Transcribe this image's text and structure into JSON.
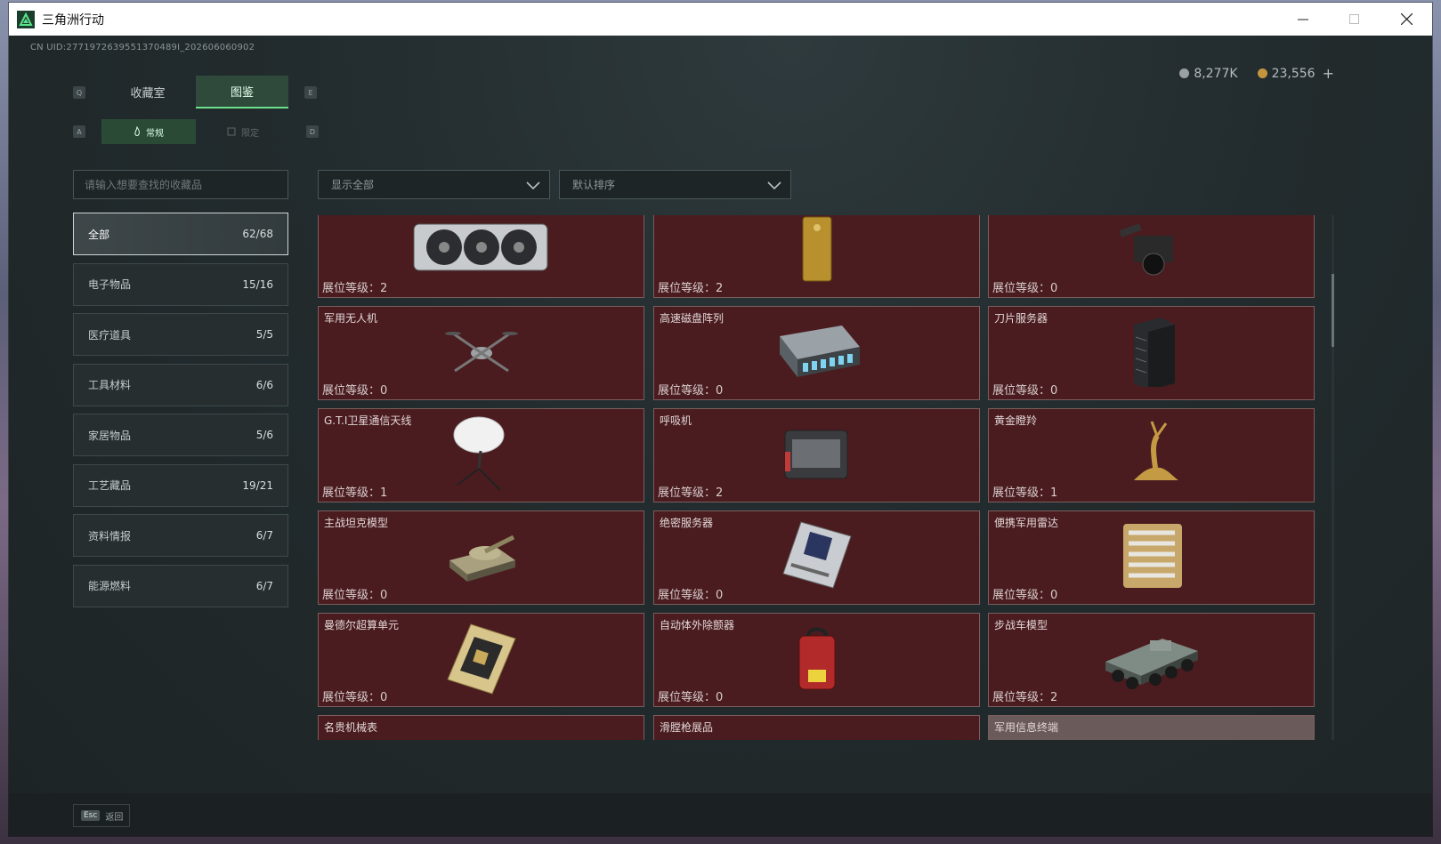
{
  "window": {
    "title": "三角洲行动"
  },
  "header": {
    "uid": "CN UID:2771972639551370489I_202606060902",
    "silver": "8,277K",
    "gold": "23,556",
    "plus": "+"
  },
  "keys": {
    "tab_left": "Q",
    "tab_right": "E",
    "sub_left": "A",
    "sub_right": "D"
  },
  "tabs": [
    {
      "label": "收藏室",
      "active": false
    },
    {
      "label": "图鉴",
      "active": true
    }
  ],
  "subtabs": [
    {
      "label": "常规",
      "active": true
    },
    {
      "label": "限定",
      "active": false
    }
  ],
  "search": {
    "placeholder": "请输入想要查找的收藏品"
  },
  "filters": {
    "show": "显示全部",
    "sort": "默认排序"
  },
  "categories": [
    {
      "label": "全部",
      "count": "62/68",
      "active": true
    },
    {
      "label": "电子物品",
      "count": "15/16"
    },
    {
      "label": "医疗道具",
      "count": "5/5"
    },
    {
      "label": "工具材料",
      "count": "6/6"
    },
    {
      "label": "家居物品",
      "count": "5/6"
    },
    {
      "label": "工艺藏品",
      "count": "19/21"
    },
    {
      "label": "资料情报",
      "count": "6/7"
    },
    {
      "label": "能源燃料",
      "count": "6/7"
    }
  ],
  "level_prefix": "展位等级：",
  "items": [
    {
      "name": "",
      "level": "2",
      "icon": "gpu-icon"
    },
    {
      "name": "",
      "level": "2",
      "icon": "gold-bar-icon"
    },
    {
      "name": "",
      "level": "0",
      "icon": "camera-rig-icon"
    },
    {
      "name": "军用无人机",
      "level": "0",
      "icon": "drone-icon"
    },
    {
      "name": "高速磁盘阵列",
      "level": "0",
      "icon": "disk-array-icon"
    },
    {
      "name": "刀片服务器",
      "level": "0",
      "icon": "blade-server-icon"
    },
    {
      "name": "G.T.I卫星通信天线",
      "level": "1",
      "icon": "satellite-dish-icon"
    },
    {
      "name": "呼吸机",
      "level": "2",
      "icon": "ventilator-icon"
    },
    {
      "name": "黄金瞪羚",
      "level": "1",
      "icon": "golden-gazelle-icon"
    },
    {
      "name": "主战坦克模型",
      "level": "0",
      "icon": "tank-model-icon"
    },
    {
      "name": "绝密服务器",
      "level": "0",
      "icon": "secret-server-icon"
    },
    {
      "name": "便携军用雷达",
      "level": "0",
      "icon": "radar-icon"
    },
    {
      "name": "曼德尔超算单元",
      "level": "0",
      "icon": "supercompute-unit-icon"
    },
    {
      "name": "自动体外除颤器",
      "level": "0",
      "icon": "defibrillator-icon"
    },
    {
      "name": "步战车模型",
      "level": "2",
      "icon": "ifv-model-icon"
    },
    {
      "name": "名贵机械表",
      "level": "",
      "icon": "watch-icon"
    },
    {
      "name": "滑膛枪展品",
      "level": "",
      "icon": "musket-icon"
    },
    {
      "name": "军用信息终端",
      "level": "",
      "icon": "info-terminal-icon"
    }
  ],
  "footer": {
    "esc_key": "Esc",
    "back_label": "返回"
  }
}
